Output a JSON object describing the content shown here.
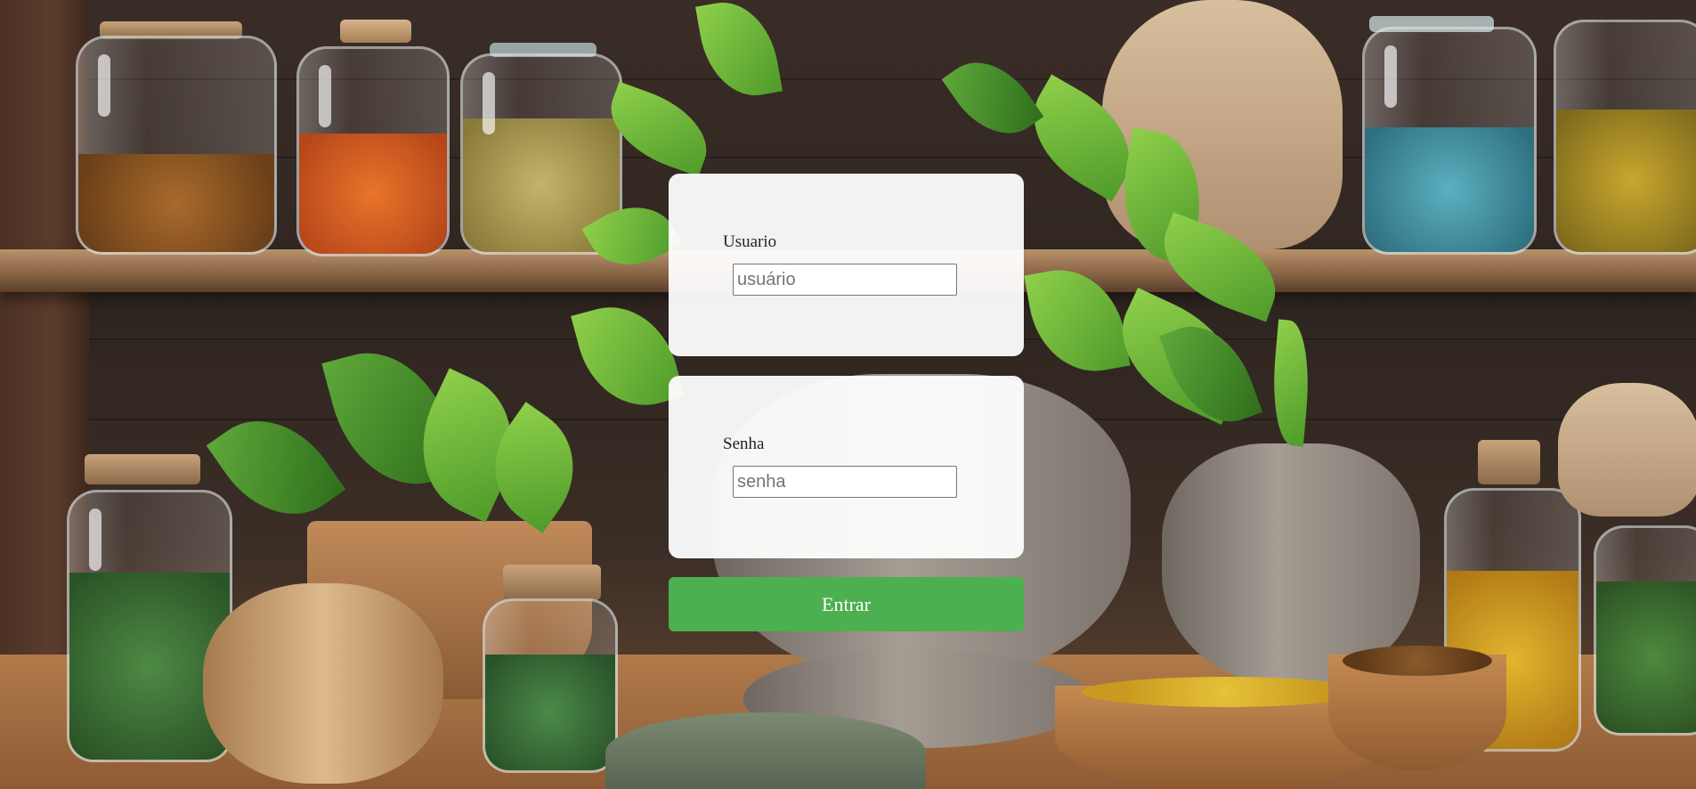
{
  "colors": {
    "card_background": "#ffffff",
    "submit_background": "#4cb050",
    "submit_text": "#ffffff"
  },
  "background": {
    "description_icon": "herbal-apothecary-illustration"
  },
  "login": {
    "username": {
      "label": "Usuario",
      "placeholder": "usuário",
      "value": ""
    },
    "password": {
      "label": "Senha",
      "placeholder": "senha",
      "value": ""
    },
    "submit_label": "Entrar"
  }
}
